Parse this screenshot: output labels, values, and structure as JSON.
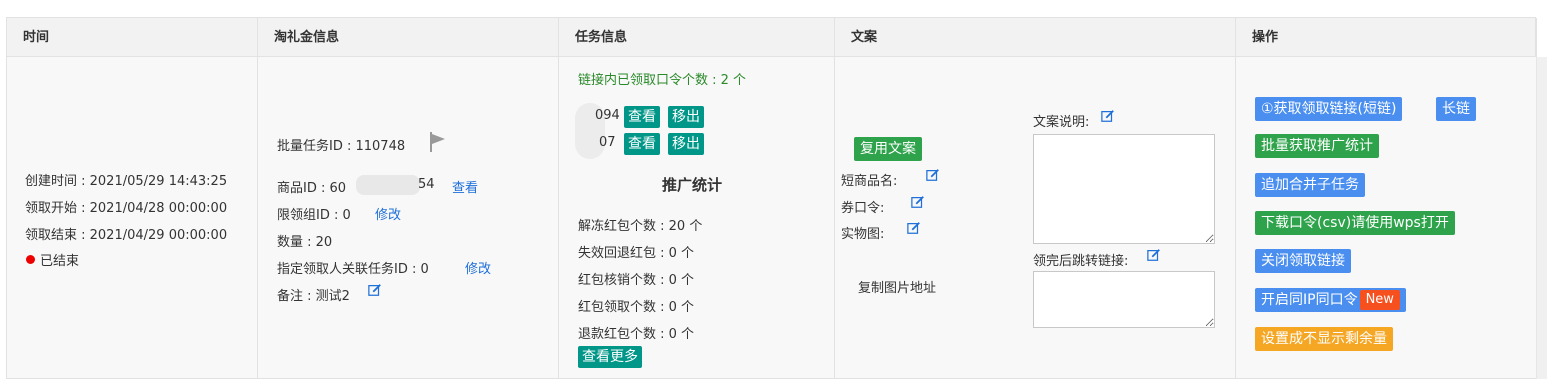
{
  "header": {
    "col_time": "时间",
    "col_coupon": "淘礼金信息",
    "col_task": "任务信息",
    "col_copy": "文案",
    "col_ops": "操作"
  },
  "time": {
    "created": "创建时间 : 2021/05/29 14:43:25",
    "claim_start": "领取开始 : 2021/04/28 00:00:00",
    "claim_end": "领取结束 : 2021/04/29 00:00:00",
    "status": "已结束",
    "status_color": "#e00000"
  },
  "coupon": {
    "batch_id": "批量任务ID : 110748",
    "product_id_prefix": "商品ID : 60",
    "product_id_suffix": "54",
    "view_link": "查看",
    "group_id": "限领组ID : 0",
    "group_edit": "修改",
    "quantity": "数量 : 20",
    "assoc_task": "指定领取人关联任务ID : 0",
    "assoc_edit": "修改",
    "note": "备注 : 测试2"
  },
  "task": {
    "claimed_count": "链接内已领取口令个数 : 2 个",
    "entries": [
      {
        "id_suffix": "094",
        "view": "查看",
        "remove": "移出"
      },
      {
        "id_suffix": "07",
        "view": "查看",
        "remove": "移出"
      }
    ],
    "stats_title": "推广统计",
    "stats": [
      "解冻红包个数 : 20 个",
      "失效回退红包 : 0 个",
      "红包核销个数 : 0 个",
      "红包领取个数 : 0 个",
      "退款红包个数 : 0 个"
    ],
    "more_button": "查看更多"
  },
  "copy": {
    "reuse_button": "复用文案",
    "short_name": "短商品名:",
    "coupon_code": "券口令:",
    "real_image": "实物图:",
    "copy_image_url": "复制图片地址",
    "desc_label": "文案说明:",
    "redirect_label": "领完后跳转链接:"
  },
  "ops": {
    "get_short_link": "①获取领取链接(短链)",
    "long_link": "长链",
    "batch_stats": "批量获取推广统计",
    "append_merge": "追加合并子任务",
    "download_csv": "下载口令(csv)请使用wps打开",
    "close_link": "关闭领取链接",
    "enable_ip": "开启同IP同口令",
    "new_badge": "New",
    "hide_remaining": "设置成不显示剩余量"
  },
  "colors": {
    "blue": "#4a8ff0",
    "green": "#2ea34b",
    "orange": "#f5a623",
    "teal": "#009688",
    "link": "#1e6fd9",
    "new_badge": "#f5501e"
  }
}
